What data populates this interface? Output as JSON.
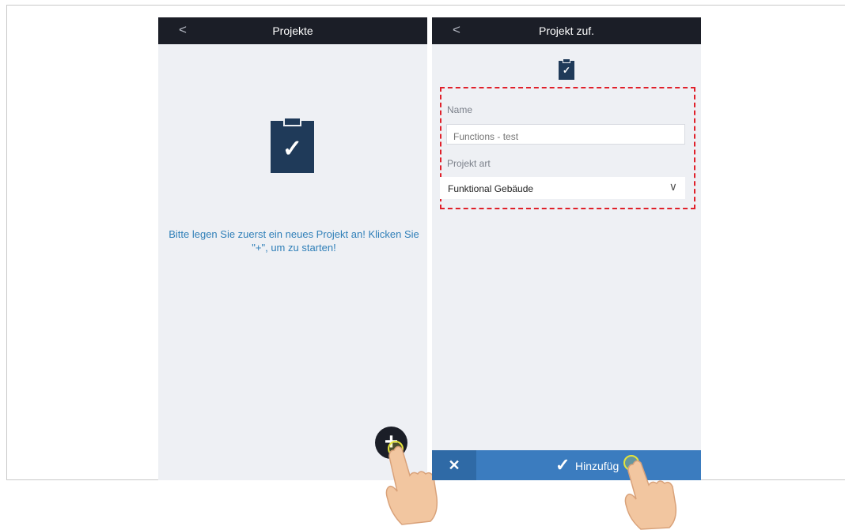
{
  "screen1": {
    "nav": {
      "back": "<",
      "title": "Projekte"
    },
    "icon": {
      "name": "clipboard-check-icon",
      "check": "✓"
    },
    "message_line1": "Bitte legen Sie zuerst ein neues Projekt an! Klicken Sie",
    "message_line2": "\"+\", um zu starten!",
    "fab": {
      "label": "+"
    }
  },
  "screen2": {
    "nav": {
      "back": "<",
      "title": "Projekt zuf."
    },
    "icon": {
      "name": "clipboard-check-icon",
      "check": "✓"
    },
    "form": {
      "name_label": "Name",
      "name_placeholder": "Functions - test",
      "type_label": "Projekt art",
      "type_value": "Funktional Gebäude",
      "type_chevron": "∨"
    },
    "bottom": {
      "cancel": "✕",
      "add_check": "✓",
      "add_label": "Hinzufüg"
    }
  },
  "colors": {
    "navbar": "#1b1e27",
    "accent": "#3b7cbf",
    "icon": "#1f3a59",
    "highlight": "#e0202a",
    "touch": "#e4e43a"
  }
}
